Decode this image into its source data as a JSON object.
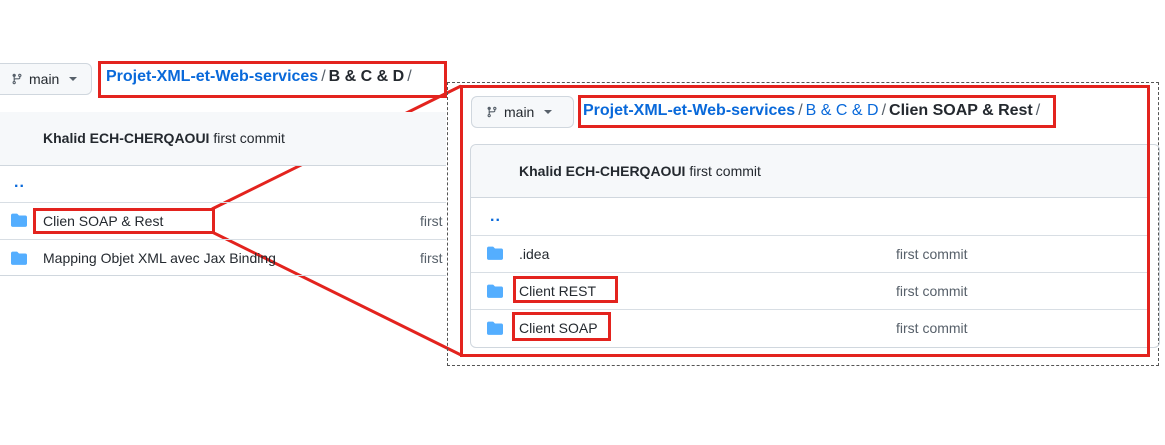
{
  "left": {
    "branch": "main",
    "breadcrumb": {
      "repo": "Projet-XML-et-Web-services",
      "sep": "/",
      "folder": "B & C & D",
      "trail": "/"
    },
    "commit": {
      "author": "Khalid ECH-CHERQAOUI",
      "message": "first commit"
    },
    "parent_link": "..",
    "rows": [
      {
        "name": "Clien SOAP & Rest",
        "commit": "first"
      },
      {
        "name": "Mapping Objet XML avec Jax Binding",
        "commit": "first"
      }
    ]
  },
  "right": {
    "branch": "main",
    "breadcrumb": {
      "repo": "Projet-XML-et-Web-services",
      "sep1": "/",
      "folder": "B & C & D",
      "sep2": "/",
      "current": "Clien SOAP & Rest",
      "trail": "/"
    },
    "commit": {
      "author": "Khalid ECH-CHERQAOUI",
      "message": "first commit"
    },
    "parent_link": "..",
    "rows": [
      {
        "name": ".idea",
        "commit": "first commit"
      },
      {
        "name": "Client REST",
        "commit": "first commit"
      },
      {
        "name": "Client SOAP",
        "commit": "first commit"
      }
    ]
  },
  "colors": {
    "highlight": "#e3231e",
    "link": "#0969da",
    "folder": "#54aeff"
  },
  "icons": [
    "git-branch-icon",
    "caret-down-icon",
    "folder-icon"
  ]
}
